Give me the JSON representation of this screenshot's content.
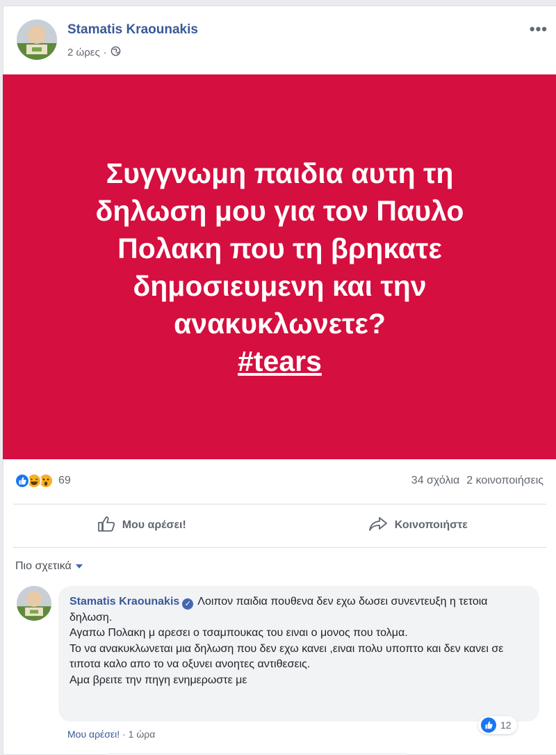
{
  "post": {
    "author": "Stamatis Kraounakis",
    "time": "2 ώρες",
    "separator": "·",
    "more_label": "•••",
    "banner_text": "Συγγνωμη παιδια αυτη τη δηλωση μου για τον Παυλο Πολακη που τη βρηκατε δημοσιευμενη και την ανακυκλωνετε?",
    "hashtag": "#tears",
    "banner_color": "#d50f3f",
    "reaction_count": "69",
    "comments_count": "34 σχόλια",
    "shares_count": "2 κοινοποιήσεις",
    "like_label": "Μου αρέσει!",
    "share_label": "Κοινοποιήστε"
  },
  "comments_section": {
    "sort_label": "Πιο σχετικά",
    "comment": {
      "author": "Stamatis Kraounakis",
      "text": "Λοιπον παιδια πουθενα δεν εχω δωσει συνεντευξη η τετοια δηλωση.\nΑγαπω Πολακη μ αρεσει ο τσαμπουκας του ειναι ο μονος που τολμα.\nΤο να ανακυκλωνεται μια δηλωση που δεν εχω κανει ,ειναι πολυ υποπτο και δεν κανει σε τιποτα καλο απο το να οξυνει ανοητες αντιθεσεις.\nΑμα βρειτε την πηγη ενημερωστε με",
      "reaction_count": "12",
      "like_label": "Μου αρέσει!",
      "separator": "·",
      "time": "1 ώρα"
    }
  },
  "icons": {
    "globe": "globe-icon",
    "like": "like-icon",
    "share": "share-icon",
    "verified": "verified-icon",
    "caret": "caret-down-icon"
  },
  "colors": {
    "link": "#385898",
    "like_blue": "#1877f2"
  }
}
